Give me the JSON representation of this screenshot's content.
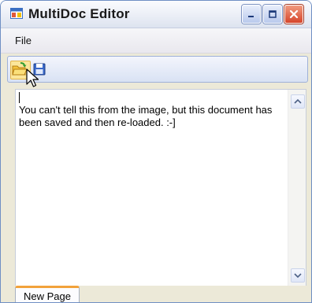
{
  "window": {
    "title": "MultiDoc Editor",
    "icon": "app-window-icon",
    "controls": [
      "minimize-icon",
      "maximize-icon",
      "close-icon"
    ]
  },
  "menu": {
    "items": [
      {
        "label": "File"
      }
    ]
  },
  "toolbar": {
    "buttons": [
      {
        "name": "open",
        "icon": "open-folder-icon",
        "state": "hovered"
      },
      {
        "name": "save",
        "icon": "floppy-disk-icon"
      }
    ]
  },
  "document": {
    "text": "You can't tell this from the image, but this document has been saved and then re-loaded. :-]"
  },
  "tabs": [
    {
      "label": "New Page",
      "selected": true
    }
  ],
  "colors": {
    "tab_accent": "#f2a23a",
    "close_button": "#d6452a",
    "toolbar_hover": "#fbe69a"
  }
}
